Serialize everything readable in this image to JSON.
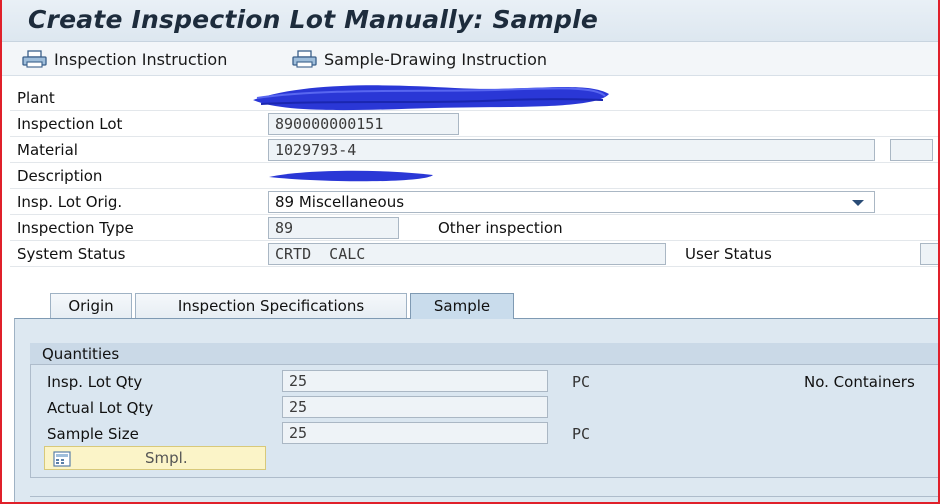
{
  "window": {
    "title": "Create Inspection Lot Manually: Sample"
  },
  "toolbar": {
    "inspection_instruction": "Inspection Instruction",
    "sample_drawing_instruction": "Sample-Drawing Instruction"
  },
  "header": {
    "plant": {
      "label": "Plant",
      "value": ""
    },
    "inspection_lot": {
      "label": "Inspection Lot",
      "value": "890000000151"
    },
    "material": {
      "label": "Material",
      "value": "1029793-4"
    },
    "description": {
      "label": "Description",
      "value": ""
    },
    "insp_lot_orig": {
      "label": "Insp. Lot Orig.",
      "value": "89 Miscellaneous"
    },
    "inspection_type": {
      "label": "Inspection Type",
      "value": "89",
      "text": "Other inspection"
    },
    "system_status": {
      "label": "System Status",
      "value": "CRTD  CALC"
    },
    "user_status": {
      "label": "User Status",
      "value": ""
    }
  },
  "tabs": [
    {
      "label": "Origin",
      "active": false
    },
    {
      "label": "Inspection Specifications",
      "active": false
    },
    {
      "label": "Sample",
      "active": true
    }
  ],
  "quantities": {
    "title": "Quantities",
    "insp_lot_qty": {
      "label": "Insp. Lot Qty",
      "value": "25",
      "unit": "PC"
    },
    "actual_lot_qty": {
      "label": "Actual Lot Qty",
      "value": "25"
    },
    "sample_size": {
      "label": "Sample Size",
      "value": "25",
      "unit": "PC"
    },
    "no_containers": {
      "label": "No. Containers"
    },
    "smpl_button": "Smpl."
  },
  "colors": {
    "redaction": "#2233cc",
    "frame": "#e0202a",
    "panel": "#dde8f1"
  }
}
